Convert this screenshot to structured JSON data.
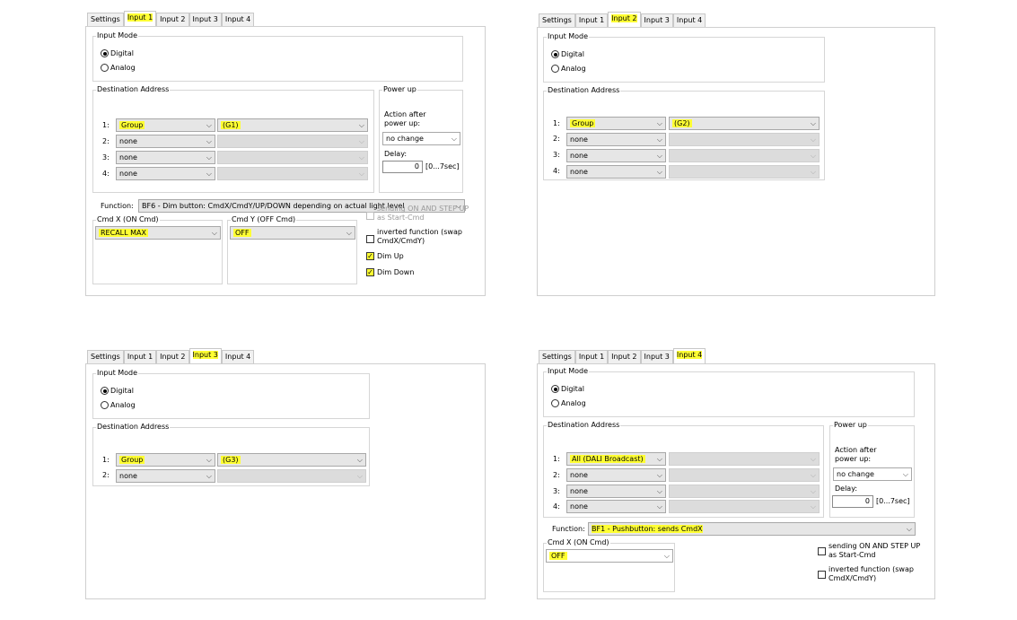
{
  "tabs": [
    "Settings",
    "Input 1",
    "Input 2",
    "Input 3",
    "Input 4"
  ],
  "common": {
    "input_mode_title": "Input Mode",
    "mode_digital": "Digital",
    "mode_analog": "Analog",
    "dest_title": "Destination Address",
    "power_up_title": "Power up",
    "action_after": "Action after",
    "power_up": "power up:",
    "delay_label": "Delay:",
    "delay_range": "[0...7sec]",
    "function_label": "Function:",
    "cmdx_title": "Cmd X  (ON Cmd)",
    "cmdy_title": "Cmd Y  (OFF Cmd)",
    "sending_line1": "sending ON AND STEP UP",
    "sending_line2": "as Start-Cmd",
    "inverted_line1": "inverted function (swap",
    "inverted_line2": "CmdX/CmdY)",
    "dim_up": "Dim Up",
    "dim_down": "Dim Down",
    "num1": "1:",
    "num2": "2:",
    "num3": "3:",
    "num4": "4:"
  },
  "panel1": {
    "selected_tab": "Input 1",
    "dest_rows": [
      {
        "type": "Group",
        "target": "(G1)"
      },
      {
        "type": "none",
        "target": ""
      },
      {
        "type": "none",
        "target": ""
      },
      {
        "type": "none",
        "target": ""
      }
    ],
    "power_up_value": "no change",
    "delay_value": "0",
    "function_value": "BF6 - Dim button:  CmdX/CmdY/UP/DOWN depending on actual light level",
    "cmdx_value": "RECALL MAX",
    "cmdy_value": "OFF",
    "dim_up_checked": true,
    "dim_down_checked": true
  },
  "panel2": {
    "selected_tab": "Input 2",
    "dest_rows": [
      {
        "type": "Group",
        "target": "(G2)"
      },
      {
        "type": "none",
        "target": ""
      },
      {
        "type": "none",
        "target": ""
      },
      {
        "type": "none",
        "target": ""
      }
    ]
  },
  "panel3": {
    "selected_tab": "Input 3",
    "dest_rows": [
      {
        "type": "Group",
        "target": "(G3)"
      },
      {
        "type": "none",
        "target": ""
      }
    ]
  },
  "panel4": {
    "selected_tab": "Input 4",
    "dest_rows": [
      {
        "type": "All (DALI Broadcast)",
        "target": ""
      },
      {
        "type": "none",
        "target": ""
      },
      {
        "type": "none",
        "target": ""
      },
      {
        "type": "none",
        "target": ""
      }
    ],
    "power_up_value": "no change",
    "delay_value": "0",
    "function_value": "BF1 - Pushbutton:  sends CmdX",
    "cmdx_value": "OFF"
  },
  "colors": {
    "highlight": "#ffff33",
    "frame_border": "#cfcfcf"
  }
}
